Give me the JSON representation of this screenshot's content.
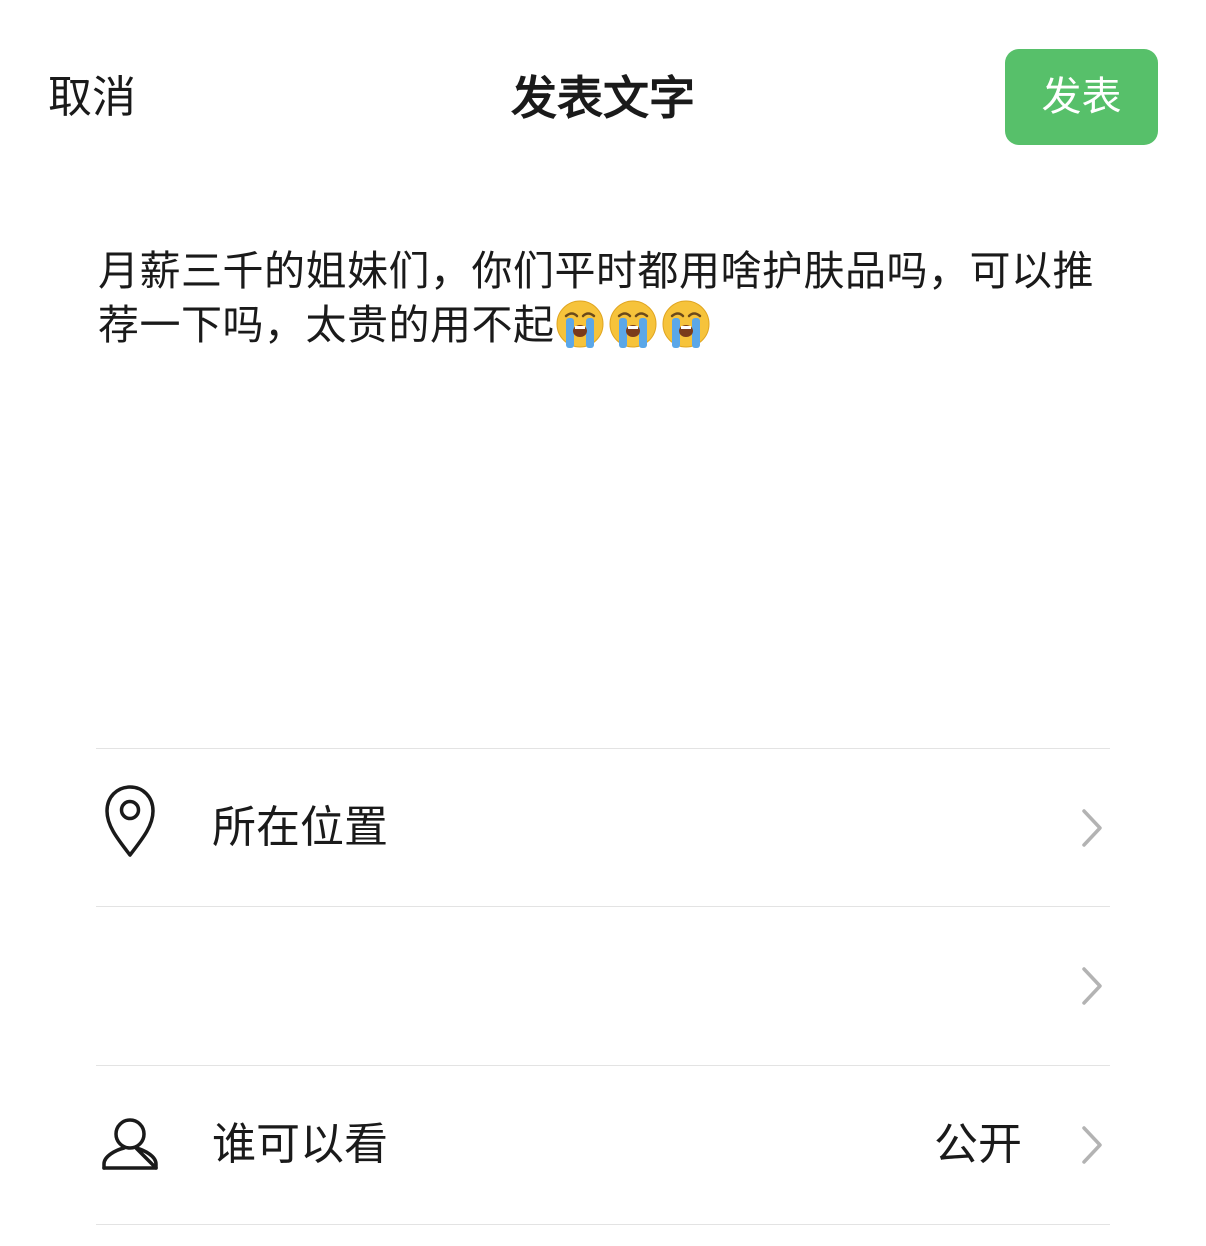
{
  "nav": {
    "cancel_label": "取消",
    "title": "发表文字",
    "publish_label": "发表",
    "publish_color": "#57c06a"
  },
  "post": {
    "text": "月薪三千的姐妹们，你们平时都用啥护肤品吗，可以推荐一下吗，太贵的用不起",
    "emojis": [
      "loudly-crying-face",
      "loudly-crying-face",
      "loudly-crying-face"
    ]
  },
  "options": {
    "location": {
      "icon": "location-pin-icon",
      "label": "所在位置"
    },
    "blank": {
      "label": ""
    },
    "visibility": {
      "icon": "person-icon",
      "label": "谁可以看",
      "value": "公开"
    }
  }
}
